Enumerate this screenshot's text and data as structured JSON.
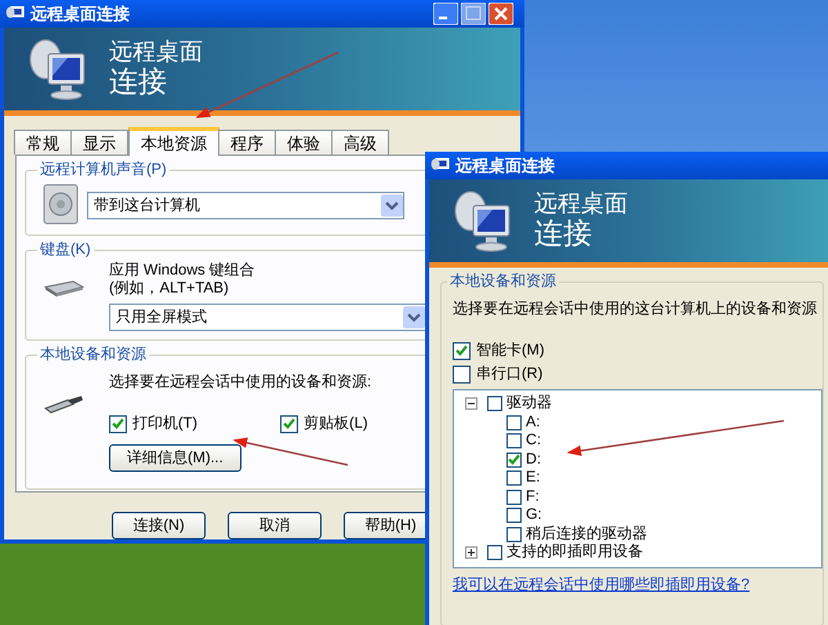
{
  "main_window": {
    "title": "远程桌面连接",
    "banner": [
      "远程桌面",
      "连接"
    ],
    "tabs": [
      {
        "label": "常规",
        "selected": false
      },
      {
        "label": "显示",
        "selected": false
      },
      {
        "label": "本地资源",
        "selected": true
      },
      {
        "label": "程序",
        "selected": false
      },
      {
        "label": "体验",
        "selected": false
      },
      {
        "label": "高级",
        "selected": false
      }
    ],
    "sound": {
      "legend": "远程计算机声音(P)",
      "value": "带到这台计算机"
    },
    "keyboard": {
      "legend": "键盘(K)",
      "description": [
        "应用 Windows 键组合",
        "(例如，ALT+TAB)"
      ],
      "value": "只用全屏模式"
    },
    "devices": {
      "legend": "本地设备和资源",
      "description": "选择要在远程会话中使用的设备和资源:",
      "options": [
        {
          "label": "打印机(T)",
          "checked": true
        },
        {
          "label": "剪贴板(L)",
          "checked": true
        }
      ],
      "details_button": "详细信息(M)..."
    },
    "buttons": [
      "连接(N)",
      "取消",
      "帮助(H)"
    ]
  },
  "details_window": {
    "title": "远程桌面连接",
    "banner": [
      "远程桌面",
      "连接"
    ],
    "legend": "本地设备和资源",
    "description": "选择要在远程会话中使用的这台计算机上的设备和资源",
    "options": [
      {
        "label": "智能卡(M)",
        "checked": true
      },
      {
        "label": "串行口(R)",
        "checked": false
      }
    ],
    "tree": [
      {
        "label": "驱动器",
        "checked": false,
        "expanded": true,
        "children": [
          {
            "label": "A:",
            "checked": false
          },
          {
            "label": "C:",
            "checked": false
          },
          {
            "label": "D:",
            "checked": true
          },
          {
            "label": "E:",
            "checked": false
          },
          {
            "label": "F:",
            "checked": false
          },
          {
            "label": "G:",
            "checked": false
          },
          {
            "label": "稍后连接的驱动器",
            "checked": false
          }
        ]
      },
      {
        "label": "支持的即插即用设备",
        "checked": false,
        "expanded": false
      }
    ],
    "link": "我可以在远程会话中使用哪些即插即用设备?"
  }
}
